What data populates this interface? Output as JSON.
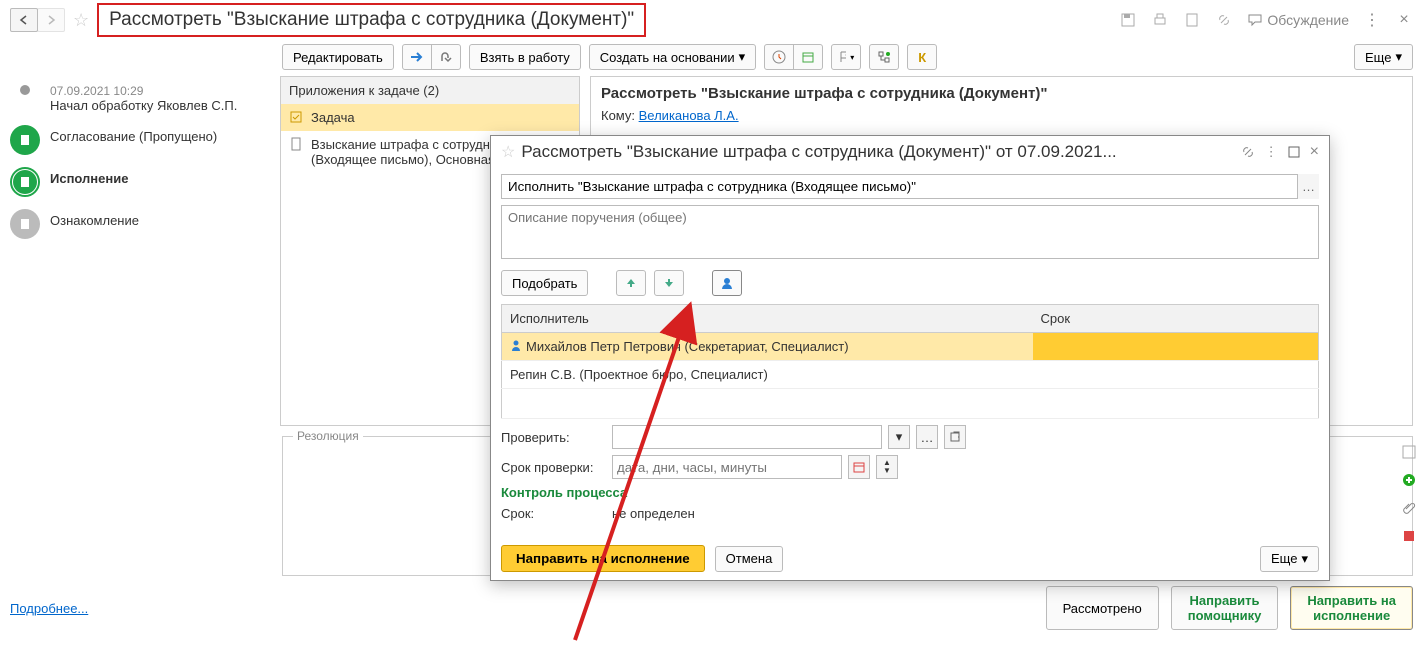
{
  "page_title": "Рассмотреть \"Взыскание штрафа с сотрудника (Документ)\"",
  "topbar_discuss": "Обсуждение",
  "toolbar": {
    "edit": "Редактировать",
    "take": "Взять в работу",
    "create_based": "Создать на основании",
    "more": "Еще"
  },
  "sidebar": {
    "step1_date": "07.09.2021 10:29",
    "step1_text": "Начал обработку Яковлев С.П.",
    "step2": "Согласование (Пропущено)",
    "step3": "Исполнение",
    "step4": "Ознакомление"
  },
  "attachments": {
    "header": "Приложения к задаче (2)",
    "item1": "Задача",
    "item2": "Взыскание штрафа с сотрудника (Входящее письмо), Основная"
  },
  "main_panel": {
    "title": "Рассмотреть \"Взыскание штрафа с сотрудника (Документ)\"",
    "to_label": "Кому: ",
    "to_link": "Великанова Л.А."
  },
  "dialog": {
    "title": "Рассмотреть \"Взыскание штрафа с сотрудника (Документ)\" от 07.09.2021...",
    "task_value": "Исполнить \"Взыскание штрафа с сотрудника (Входящее письмо)\"",
    "desc_placeholder": "Описание поручения (общее)",
    "select_btn": "Подобрать",
    "col_exec": "Исполнитель",
    "col_deadline": "Срок",
    "exec1_name": "Михайлов Петр Петрович",
    "exec1_role": " (Секретариат, Специалист)",
    "exec2": "Репин С.В. (Проектное бюро, Специалист)",
    "check_label": "Проверить:",
    "check_deadline_label": "Срок проверки:",
    "check_deadline_placeholder": "дата, дни, часы, минуты",
    "control_label": "Контроль процесса",
    "deadline_label": "Срок:",
    "deadline_value": "не определен",
    "send_btn": "Направить на исполнение",
    "cancel_btn": "Отмена",
    "more": "Еще"
  },
  "resolution_label": "Резолюция",
  "bottom": {
    "more_link": "Подробнее...",
    "reviewed": "Рассмотрено",
    "to_assistant_l1": "Направить",
    "to_assistant_l2": "помощнику",
    "to_exec_l1": "Направить на",
    "to_exec_l2": "исполнение"
  }
}
